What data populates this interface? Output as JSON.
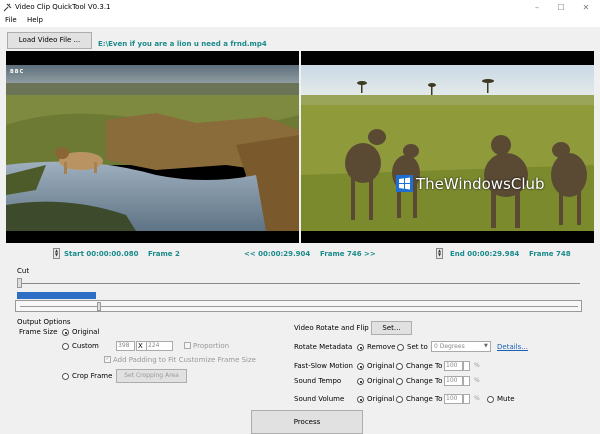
{
  "window": {
    "title": "Video Clip QuickTool V0.3.1",
    "minimize": "–",
    "maximize": "☐",
    "close": "✕"
  },
  "menu": {
    "file": "File",
    "help": "Help"
  },
  "toolbar": {
    "load_label": "Load Video File ...",
    "file_path": "E:\\Even if you are a lion u need a frnd.mp4"
  },
  "video": {
    "left_logo": "BBC",
    "watermark": "TheWindowsClub"
  },
  "timeline": {
    "start": "Start 00:00:00.080",
    "start_frame": "Frame 2",
    "middle": "<< 00:00:29.904",
    "middle_frame": "Frame 746 >>",
    "end": "End 00:00:29.984",
    "end_frame": "Frame 748",
    "spin_up": "▲",
    "spin_down": "▼"
  },
  "cut": {
    "label": "Cut",
    "progress_fraction": 0.14
  },
  "output": {
    "section_label": "Output Options",
    "frame_size_label": "Frame Size",
    "original": "Original",
    "custom": "Custom",
    "width": "398",
    "x_label": "X",
    "height": "224",
    "proportion": "Proportion",
    "add_padding": "Add Padding to Fit Customize Frame Size",
    "crop_frame": "Crop Frame",
    "set_crop_label": "Set Cropping Area",
    "rotate_flip_label": "Video Rotate and Flip",
    "set_label": "Set...",
    "rotate_meta_label": "Rotate Metadata",
    "remove": "Remove",
    "set_to": "Set to",
    "degrees": "0 Degrees",
    "details": "Details...",
    "fast_slow_label": "Fast-Slow Motion",
    "sound_tempo_label": "Sound Tempo",
    "sound_volume_label": "Sound Volume",
    "change_to": "Change To",
    "value_100": "100",
    "percent": "%",
    "mute": "Mute"
  },
  "process_label": "Process"
}
